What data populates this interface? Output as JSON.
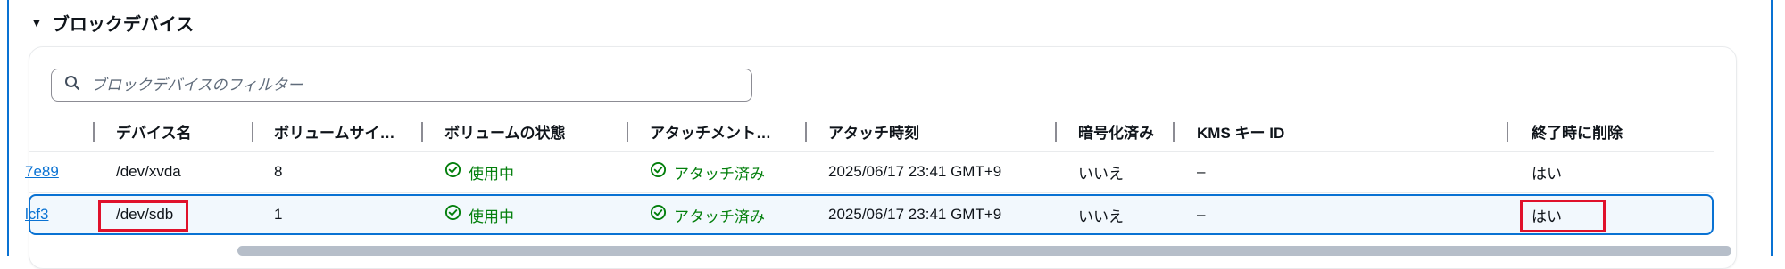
{
  "section": {
    "title": "ブロックデバイス",
    "caret_icon": "caret-down-icon"
  },
  "filter": {
    "placeholder": "ブロックデバイスのフィルター"
  },
  "columns": {
    "device_name": "デバイス名",
    "volume_size": "ボリュームサイ…",
    "volume_state": "ボリュームの状態",
    "attachment": "アタッチメント…",
    "attach_time": "アタッチ時刻",
    "encrypted": "暗号化済み",
    "kms_key_id": "KMS キー ID",
    "delete_on_term": "終了時に削除"
  },
  "rows": [
    {
      "volume_id": "7e89",
      "device_name": "/dev/xvda",
      "volume_size": "8",
      "volume_state": "使用中",
      "attachment": "アタッチ済み",
      "attach_time": "2025/06/17 23:41 GMT+9",
      "encrypted": "いいえ",
      "kms_key_id": "–",
      "delete_on_term": "はい"
    },
    {
      "volume_id": "lcf3",
      "device_name": "/dev/sdb",
      "volume_size": "1",
      "volume_state": "使用中",
      "attachment": "アタッチ済み",
      "attach_time": "2025/06/17 23:41 GMT+9",
      "encrypted": "いいえ",
      "kms_key_id": "–",
      "delete_on_term": "はい"
    }
  ],
  "colors": {
    "accent": "#0972d3",
    "success": "#037f0c",
    "highlight": "#e0112b"
  }
}
